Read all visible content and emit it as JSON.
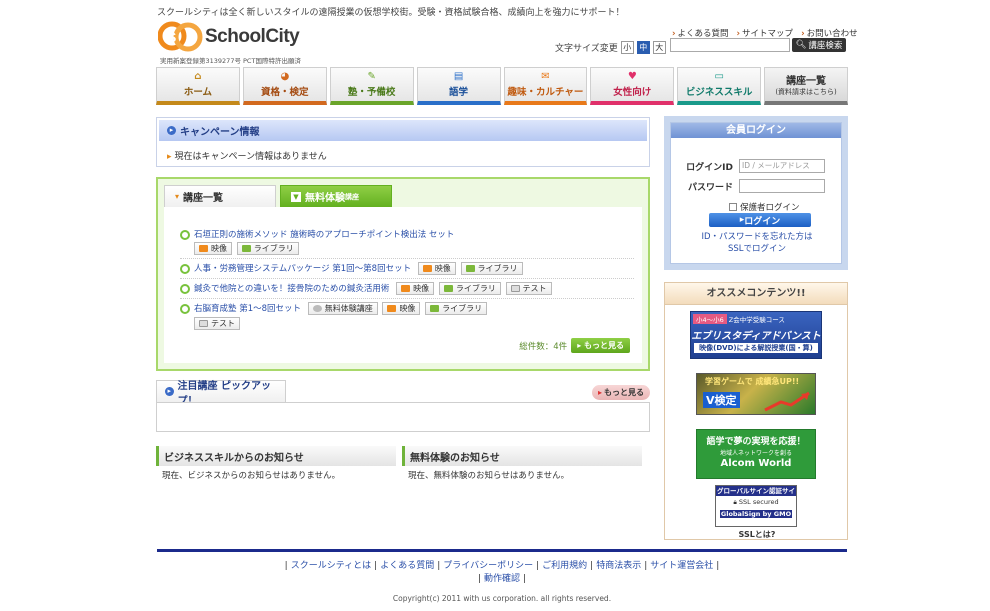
{
  "header": {
    "tagline": "スクールシティは全く新しいスタイルの遠隔授業の仮想学校街。受験・資格試験合格、成績向上を強力にサポート！",
    "logo_text": "SchoolCity",
    "logo_sub": "実用新案登録第3139277号 PCT国際特許出願済",
    "font_size_label": "文字サイズ変更",
    "font_sizes": [
      "小",
      "中",
      "大"
    ],
    "top_links": [
      "よくある質問",
      "サイトマップ",
      "お問い合わせ"
    ],
    "search_button": "講座検索"
  },
  "nav": [
    {
      "label": "ホーム",
      "icon": "home-icon",
      "color": "#c4891a"
    },
    {
      "label": "資格・検定",
      "icon": "clock-icon",
      "color": "#d2691e"
    },
    {
      "label": "塾・予備校",
      "icon": "pencil-icon",
      "color": "#6aa52a"
    },
    {
      "label": "語学",
      "icon": "book-icon",
      "color": "#2a6fc9"
    },
    {
      "label": "趣味・カルチャー",
      "icon": "mail-icon",
      "color": "#e8791a"
    },
    {
      "label": "女性向け",
      "icon": "heart-icon",
      "color": "#e0306a"
    },
    {
      "label": "ビジネススキル",
      "icon": "pc-icon",
      "color": "#1a9a8a"
    },
    {
      "label": "講座一覧",
      "sub": "(資料請求はこちら)"
    }
  ],
  "campaign": {
    "title": "キャンペーン情報",
    "body": "現在はキャンペーン情報はありません"
  },
  "courses": {
    "tab_list": "講座一覧",
    "tab_trial": "無料体験",
    "tab_trial_small": "講座",
    "items": [
      {
        "title": "石垣正則の施術メソッド 施術時のアプローチポイント検出法 セット",
        "badges": [
          "映像",
          "ライブラリ"
        ]
      },
      {
        "title": "人事・労務管理システムパッケージ 第1回〜第8回セット",
        "badges": [
          "映像",
          "ライブラリ"
        ]
      },
      {
        "title": "鍼灸で他院との違いを！接骨院のための鍼灸活用術",
        "badges": [
          "映像",
          "ライブラリ",
          "テスト"
        ]
      },
      {
        "title": "右脳育成塾 第1〜8回セット",
        "badges": [
          "無料体験講座",
          "映像",
          "ライブラリ",
          "テスト"
        ]
      }
    ],
    "total": "総件数：4件",
    "more": "もっと見る"
  },
  "pickup": {
    "title": "注目講座 ピックアップ！",
    "more": "もっと見る"
  },
  "news": {
    "business_title": "ビジネススキルからのお知らせ",
    "business_body": "現在、ビジネスからのお知らせはありません。",
    "trial_title": "無料体験のお知らせ",
    "trial_body": "現在、無料体験のお知らせはありません。"
  },
  "login": {
    "title": "会員ログイン",
    "id_label": "ログインID",
    "id_placeholder": "ID / メールアドレス",
    "password_label": "パスワード",
    "save_label": "保護者ログイン",
    "button": "ログイン",
    "forgot_line1": "ID・パスワードを忘れた方は",
    "forgot_line2": "SSLでログイン"
  },
  "recommend": {
    "title": "オススメコンテンツ!!",
    "banner1_tag": "小4〜小6",
    "banner1_course": "Z会中学受験コース",
    "banner1_main": "エブリスタディアドバンスト",
    "banner1_sub": "映像(DVD)による解説授業(国・算)",
    "banner2_text": "学習ゲームで 成績急UP!!",
    "banner2_logo": "V検定",
    "banner3_main": "語学で夢の実現を応援！",
    "banner3_sub": "地域人ネットワークを創る",
    "banner3_logo": "Alcom World",
    "banner4_head": "グローバルサイン認証サイト",
    "banner4_mid": "SSL secured",
    "banner4_foot": "GlobalSign by GMO",
    "ssl_question": "SSLとは?"
  },
  "footer": {
    "links": [
      "スクールシティとは",
      "よくある質問",
      "プライバシーポリシー",
      "ご利用規約",
      "特商法表示",
      "サイト運営会社",
      "動作確認"
    ],
    "copyright": "Copyright(c) 2011 with us corporation. all rights reserved."
  }
}
